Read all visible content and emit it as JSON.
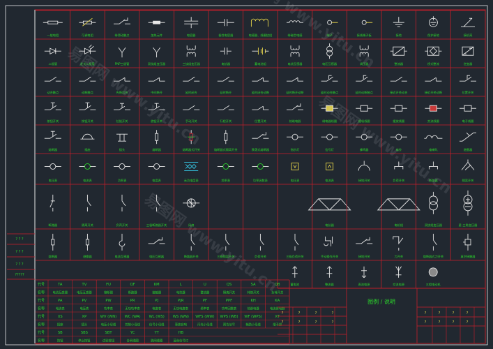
{
  "drawing": {
    "title_block_title": "图例 / 说明",
    "frame_color": "#c81e2a",
    "symbol_color": "#e8e8e8",
    "label_color": "#2bd62b",
    "accent_colors": [
      "#e8d64a",
      "#35c8e6",
      "#d9d9d9"
    ],
    "watermark_text": "易图网 www.yitu.cn"
  },
  "symbol_rows": [
    {
      "icons": [
        "resistor",
        "variable-resistor",
        "switch-contact",
        "resistor-small",
        "capacitor",
        "capacitor-var",
        "inductor-coil",
        "inductor",
        "probe-node",
        "probe-node",
        "ground",
        "ground-circle",
        "arrow-diag"
      ],
      "labels": [
        "一般电阻",
        "可调电阻",
        "带滑动触点",
        "加热元件",
        "电容器",
        "极性电容器",
        "电感器、线圈绕组",
        "带磁芯电感",
        "端子",
        "接线端子板",
        "接地",
        "保护接地",
        "接机壳"
      ]
    },
    {
      "icons": [
        "diode",
        "led",
        "y-branch",
        "y-branch",
        "transformer",
        "cap-small",
        "battery",
        "transformer",
        "transformer-circle",
        "transformer",
        "box-cross",
        "box-diamond",
        "box-diag"
      ],
      "labels": [
        "二极管",
        "发光二极管",
        "PNP三极管",
        "双绕组变压器",
        "三绕组变压器",
        "电抗器",
        "蓄电池组",
        "电流互感器",
        "电压互感器",
        "调压器",
        "整流器",
        "桥式整流",
        "逆变器"
      ]
    },
    {
      "icons": [
        "contact-no",
        "contact-no",
        "contact-nc",
        "contact-nc",
        "contact-no",
        "contact-no",
        "contact-nc",
        "contact-nc",
        "contact-time",
        "contact-time",
        "contact-no",
        "contact-nc",
        "contact-time"
      ],
      "labels": [
        "动合触点",
        "动断触点",
        "先断后合",
        "中间断开",
        "延时闭合",
        "延时断开",
        "延时闭合动断",
        "延时断开动断",
        "延时动合触点",
        "延时动断触点",
        "接近开关动合",
        "接近开关动断",
        "位置开关"
      ]
    },
    {
      "icons": [
        "pushbutton",
        "pushbutton",
        "pushbutton-nc",
        "pushbutton-nc",
        "contact-no",
        "contact-no",
        "contact-nc",
        "switch-contact",
        "coil-yellow",
        "coil-small",
        "coil-small",
        "coil-red",
        "coil-small"
      ],
      "labels": [
        "按钮开关",
        "按钮开关",
        "拉拔开关",
        "旋钮开关",
        "手动开关",
        "行程开关",
        "位置开关",
        "热继电器",
        "继电器线圈",
        "缓吸线圈",
        "缓放线圈",
        "交流线圈",
        "电子线圈"
      ]
    },
    {
      "icons": [
        "pushbutton",
        "dome",
        "heater",
        "fuse",
        "fuse-red",
        "fuse",
        "switch-contact",
        "circle",
        "circle",
        "circle",
        "circle",
        "arc-contact",
        "contact-diag"
      ],
      "labels": [
        "熔断器",
        "插座",
        "插头",
        "熔断器",
        "熔断器式开关",
        "熔断器式隔离开关",
        "跌落式熔断器",
        "指示灯",
        "信号灯",
        "蜂鸣器",
        "电铃",
        "电喇叭",
        "避雷器"
      ]
    },
    {
      "icons": [
        "circle",
        "circle-green",
        "circle",
        "circle",
        "heater-cyan",
        "circle-green",
        "circle-green",
        "box-v",
        "box-a",
        "arc-up",
        "arc-fork",
        "arc-fork",
        "arc-tri"
      ],
      "labels": [
        "电压表",
        "电流表",
        "功率表",
        "电度表",
        "无功电度表",
        "频率表",
        "功率因数表",
        "电压表",
        "电流表",
        "接地开关",
        "负荷开关",
        "断路器",
        "隔离开关"
      ]
    },
    {
      "icons": [
        "switch-vertical",
        "switch-diag",
        "switch-diag",
        "switch-diag",
        "circle-fan",
        "empty",
        "empty",
        "empty",
        "bridge",
        "empty",
        "bridge",
        "double-circle",
        "motor-circle"
      ],
      "labels": [
        "断路器",
        "隔离开关",
        "负荷开关",
        "三极断路器开关",
        "风扇",
        "",
        "",
        "",
        "电抗器",
        "",
        "电机组",
        "双绕组变压器",
        "星-三角变压器"
      ]
    },
    {
      "icons": [
        "fuse-v",
        "fuse-v",
        "hook",
        "switch-contact",
        "switch-diag",
        "switch-diag",
        "switch-diag",
        "switch-diag",
        "hand-switch",
        "switch-contact",
        "bracket",
        "switch-diag",
        "coil-v"
      ],
      "labels": [
        "熔断器",
        "避雷器",
        "电流互感器",
        "电压互感器",
        "断路器开关",
        "三极隔离开关",
        "负荷开关",
        "三极负荷开关",
        "手动操作开关",
        "接地开关",
        "刀开关",
        "熔断器式刀开关",
        "真空接触器"
      ]
    },
    {
      "icons": [
        "up-arrow",
        "up-arrow",
        "down-arrow",
        "fork-arrow",
        "m-circle"
      ],
      "labels": [
        "蓄电池",
        "整流器",
        "直流电源",
        "交流电源",
        "三相电动机"
      ]
    }
  ],
  "code_table": {
    "rows": [
      {
        "codes": [
          "TA",
          "TV",
          "FU",
          "QF",
          "KM",
          "L",
          "U",
          "QS",
          "SA",
          "QB"
        ],
        "names": [
          "电流互感器",
          "电压互感器",
          "熔断器",
          "断路器",
          "接触器",
          "电抗器",
          "整流器",
          "隔离开关",
          "转换开关",
          "负荷开关"
        ]
      },
      {
        "codes": [
          "PA",
          "PV",
          "PW",
          "PR",
          "PJ",
          "PJR",
          "PF",
          "PPF",
          "KH",
          "KA"
        ],
        "names": [
          "电流表",
          "电压表",
          "功率表",
          "无功功率表",
          "电度表",
          "无功电度表",
          "频率表",
          "功率因数表",
          "热继电器",
          "电流继电器"
        ]
      },
      {
        "codes": [
          "XS",
          "XP",
          "WV (WN)",
          "WC (WA)",
          "WL (WS)",
          "WS (WN)",
          "WFS (WW)",
          "WPS (WB)",
          "WF (WPS)",
          "XT"
        ],
        "names": [
          "插座",
          "插头",
          "电压小母线",
          "控制小母线",
          "信号小母线",
          "事故音响",
          "闪光小母线",
          "预告信号",
          "辅助小母线",
          "端子排"
        ]
      },
      {
        "codes": [
          "SB",
          "SBS",
          "SBT",
          "YC",
          "YT",
          "HB"
        ],
        "names": [
          "按钮",
          "停止按钮",
          "试验按钮",
          "合闸线圈",
          "跳闸线圈",
          "蓝色信号灯"
        ]
      }
    ],
    "row_heads": [
      "代号",
      "名称"
    ]
  },
  "revision_block": {
    "rows": [
      "? ? ?",
      "? ? ?",
      "? ? ?",
      "?????"
    ],
    "header_cells": [
      "?",
      "?",
      "?",
      "?",
      "?",
      "?",
      "?",
      "?"
    ]
  }
}
